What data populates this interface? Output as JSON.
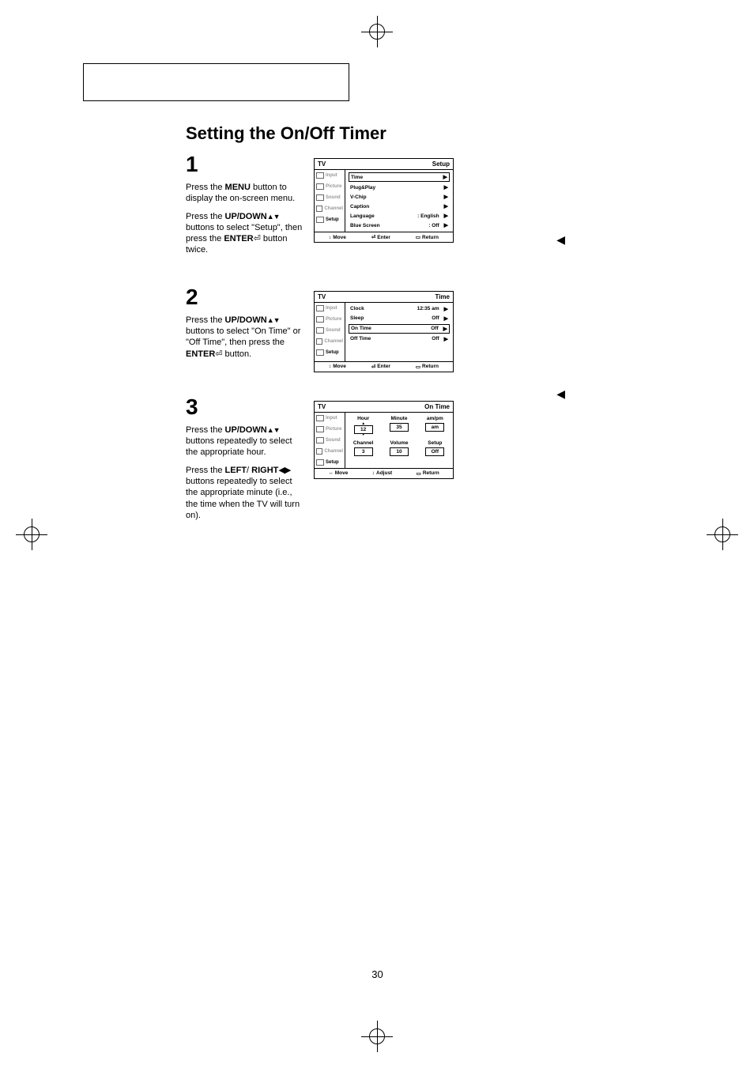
{
  "title": "Setting the On/Off Timer",
  "page_number": "30",
  "steps": [
    {
      "num": "1",
      "paragraphs": [
        {
          "pre": "Press the ",
          "bold": "MENU",
          "post": " button to display the on-screen menu."
        },
        {
          "pre": "Press the ",
          "bold": "UP/DOWN",
          "arrows": "▲▼",
          "post": " buttons to select \"Setup\", then press the ",
          "bold2": "ENTER",
          "enter_icon": true,
          "post2": " button twice."
        }
      ],
      "osd": {
        "header_left": "TV",
        "header_right": "Setup",
        "sidebar": [
          "Input",
          "Picture",
          "Sound",
          "Channel",
          "Setup"
        ],
        "active_sidebar": 4,
        "rows": [
          {
            "label": "Time",
            "value": "",
            "selected": true,
            "caret": true
          },
          {
            "label": "Plug&Play",
            "value": "",
            "caret": true
          },
          {
            "label": "V-Chip",
            "value": "",
            "caret": true
          },
          {
            "label": "Caption",
            "value": "",
            "caret": true
          },
          {
            "label": "Language",
            "value": ":   English",
            "caret": true
          },
          {
            "label": "Blue Screen",
            "value": ":   Off",
            "caret": true
          }
        ],
        "footer": [
          {
            "icon": "↕",
            "text": "Move"
          },
          {
            "icon": "⏎",
            "text": "Enter"
          },
          {
            "icon": "▭",
            "text": "Return"
          }
        ]
      }
    },
    {
      "num": "2",
      "paragraphs": [
        {
          "pre": "Press the ",
          "bold": "UP/DOWN",
          "arrows": "▲▼",
          "post": " buttons to select \"On Time\" or \"Off Time\", then press the ",
          "bold2": "ENTER",
          "enter_icon": true,
          "post2": " button."
        }
      ],
      "osd": {
        "header_left": "TV",
        "header_right": "Time",
        "sidebar": [
          "Input",
          "Picture",
          "Sound",
          "Channel",
          "Setup"
        ],
        "active_sidebar": 4,
        "rows": [
          {
            "label": "Clock",
            "value": "12:35 am",
            "caret": true
          },
          {
            "label": "Sleep",
            "value": "Off",
            "caret": true
          },
          {
            "label": "On Time",
            "value": "Off",
            "selected": true,
            "caret": true
          },
          {
            "label": "Off Time",
            "value": "Off",
            "caret": true
          }
        ],
        "footer": [
          {
            "icon": "↕",
            "text": "Move"
          },
          {
            "icon": "⏎",
            "text": "Enter"
          },
          {
            "icon": "▭",
            "text": "Return"
          }
        ]
      }
    },
    {
      "num": "3",
      "paragraphs": [
        {
          "pre": "Press the ",
          "bold": "UP/DOWN",
          "arrows": "▲▼",
          "post": " buttons repeatedly to select the appropriate hour."
        },
        {
          "pre": "Press the ",
          "bold": "LEFT",
          "mid": "/ ",
          "bold2": "RIGHT",
          "arrows2": "◀▶",
          "post": " buttons repeatedly to select the appropriate minute (i.e., the time when the TV will turn on)."
        }
      ],
      "osd3": {
        "header_left": "TV",
        "header_right": "On Time",
        "sidebar": [
          "Input",
          "Picture",
          "Sound",
          "Channel",
          "Setup"
        ],
        "active_sidebar": 4,
        "row1": [
          {
            "hdr": "Hour",
            "val": "12",
            "updn": true
          },
          {
            "hdr": "Minute",
            "val": "35"
          },
          {
            "hdr": "am/pm",
            "val": "am"
          }
        ],
        "row2": [
          {
            "hdr": "Channel",
            "val": "3"
          },
          {
            "hdr": "Volume",
            "val": "10"
          },
          {
            "hdr": "Setup",
            "val": "Off"
          }
        ],
        "footer": [
          {
            "icon": "↔",
            "text": "Move"
          },
          {
            "icon": "↕",
            "text": "Adjust"
          },
          {
            "icon": "▭",
            "text": "Return"
          }
        ]
      }
    }
  ]
}
